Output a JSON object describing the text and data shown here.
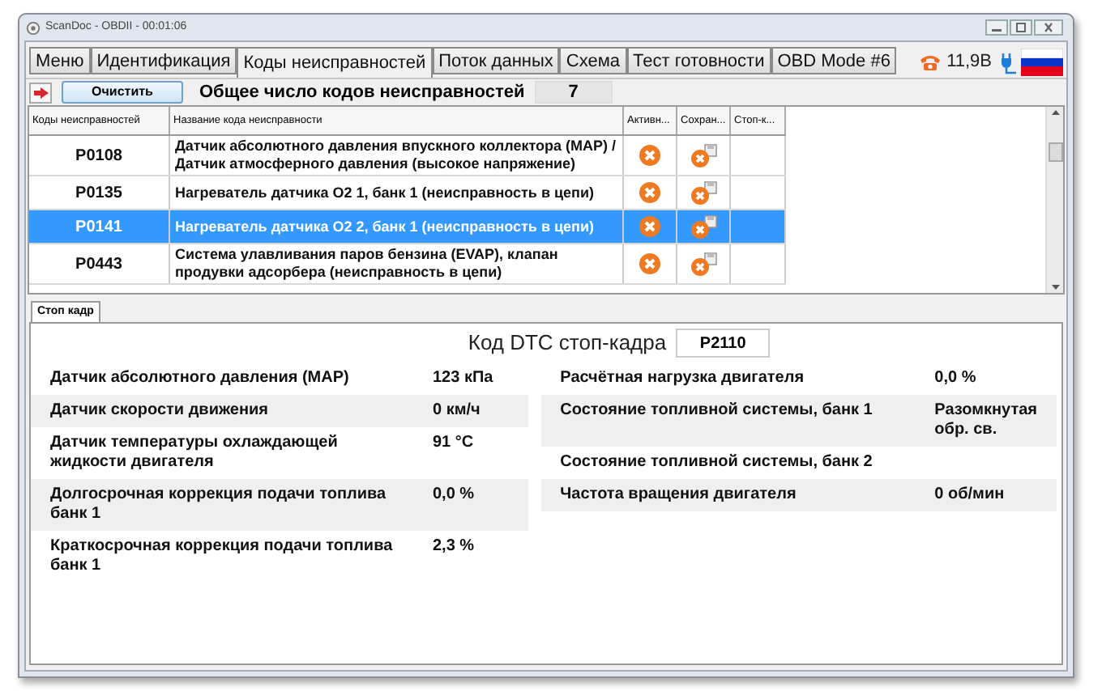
{
  "window": {
    "title": "ScanDoc - OBDII - 00:01:06"
  },
  "tabs": [
    {
      "label": "Меню",
      "selected": false
    },
    {
      "label": "Идентификация",
      "selected": false
    },
    {
      "label": "Коды неисправностей",
      "selected": true
    },
    {
      "label": "Поток данных",
      "selected": false
    },
    {
      "label": "Схема",
      "selected": false
    },
    {
      "label": "Тест готовности",
      "selected": false
    },
    {
      "label": "OBD Mode #6",
      "selected": false
    }
  ],
  "status": {
    "voltage": "11,9В"
  },
  "toolbar": {
    "clear_button": "Очистить",
    "total_label": "Общее число кодов неисправностей",
    "total_value": "7"
  },
  "dtc_table": {
    "columns": [
      "Коды неисправностей",
      "Название кода неисправности",
      "Активн...",
      "Сохран...",
      "Стоп-к..."
    ],
    "rows": [
      {
        "code": "P0108",
        "name": "Датчик абсолютного давления впускного коллектора (MAP) / Датчик атмосферного давления (высокое напряжение)",
        "active": true,
        "saved": true,
        "selected": false
      },
      {
        "code": "P0135",
        "name": "Нагреватель датчика O2 1, банк 1 (неисправность в цепи)",
        "active": true,
        "saved": true,
        "selected": false
      },
      {
        "code": "P0141",
        "name": "Нагреватель датчика O2 2, банк 1 (неисправность в цепи)",
        "active": true,
        "saved": true,
        "selected": true
      },
      {
        "code": "P0443",
        "name": "Система улавливания паров бензина (EVAP), клапан продувки адсорбера (неисправность в цепи)",
        "active": true,
        "saved": true,
        "selected": false
      }
    ]
  },
  "freeze_frame": {
    "tab": "Стоп кадр",
    "dtc_label": "Код DTC стоп-кадра",
    "dtc_value": "P2110",
    "left": [
      {
        "label": "Датчик абсолютного давления (MAP)",
        "value": "123 кПа"
      },
      {
        "label": "Датчик скорости движения",
        "value": "0 км/ч"
      },
      {
        "label": "Датчик температуры охлаждающей жидкости двигателя",
        "value": "91 °C"
      },
      {
        "label": "Долгосрочная коррекция подачи топлива банк 1",
        "value": "0,0 %"
      },
      {
        "label": "Краткосрочная коррекция подачи топлива банк 1",
        "value": "2,3 %"
      }
    ],
    "right": [
      {
        "label": "Расчётная нагрузка двигателя",
        "value": "0,0 %"
      },
      {
        "label": "Состояние топливной системы, банк 1",
        "value": "Разомкнутая обр. св."
      },
      {
        "label": "Состояние топливной системы, банк 2"
      },
      {
        "label": "Частота вращения двигателя",
        "value": "0 об/мин"
      }
    ]
  }
}
